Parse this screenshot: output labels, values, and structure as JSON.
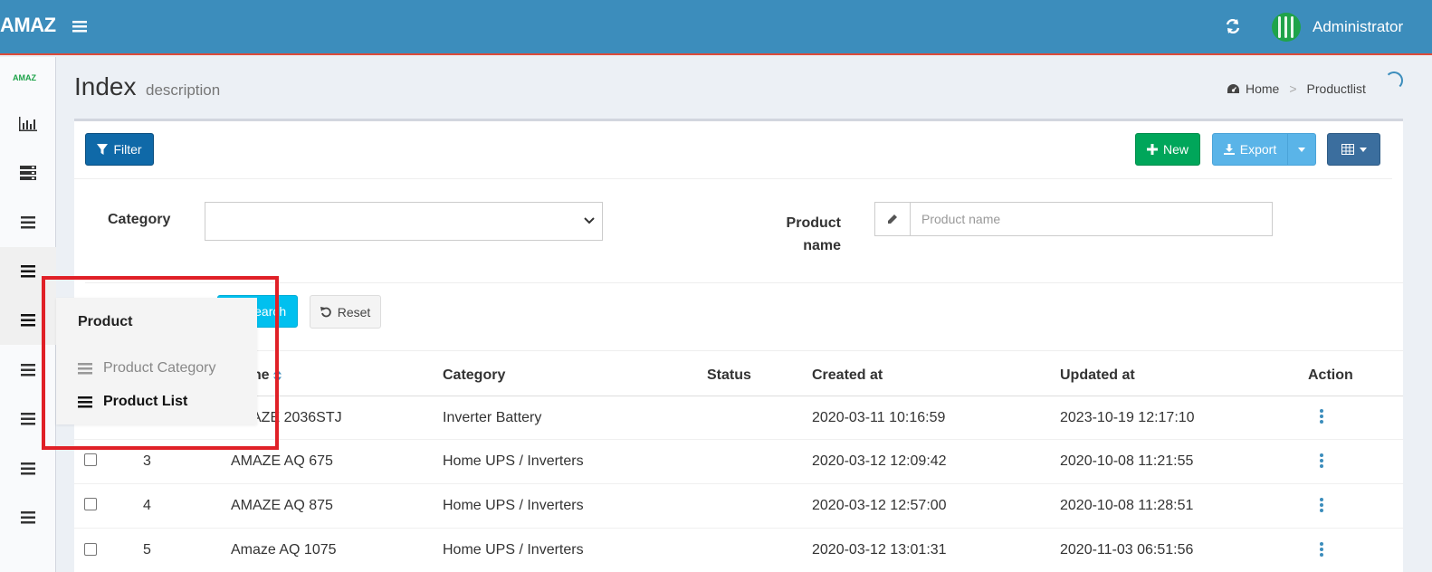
{
  "header": {
    "brand": "AMAZ",
    "user": "Administrator"
  },
  "sidebar": {
    "logo": "AMAZ"
  },
  "page": {
    "title": "Index",
    "description": "description",
    "breadcrumb": [
      {
        "label": "Home"
      },
      {
        "label": "Productlist"
      }
    ]
  },
  "toolbar": {
    "filter_label": "Filter",
    "new_label": "New",
    "export_label": "Export"
  },
  "filters": {
    "category_label": "Category",
    "category_value": "",
    "product_name_label_1": "Product",
    "product_name_label_2": "name",
    "product_name_placeholder": "Product name",
    "search_label": "Search",
    "reset_label": "Reset"
  },
  "table": {
    "headers": {
      "name": "Name",
      "category": "Category",
      "status": "Status",
      "created": "Created at",
      "updated": "Updated at",
      "action": "Action"
    },
    "rows": [
      {
        "id": "",
        "name": "AMAZE 2036STJ",
        "category": "Inverter Battery",
        "status": "",
        "created": "2020-03-11 10:16:59",
        "updated": "2023-10-19 12:17:10"
      },
      {
        "id": "3",
        "name": "AMAZE AQ 675",
        "category": "Home UPS / Inverters",
        "status": "",
        "created": "2020-03-12 12:09:42",
        "updated": "2020-10-08 11:21:55"
      },
      {
        "id": "4",
        "name": "AMAZE AQ 875",
        "category": "Home UPS / Inverters",
        "status": "",
        "created": "2020-03-12 12:57:00",
        "updated": "2020-10-08 11:28:51"
      },
      {
        "id": "5",
        "name": "Amaze AQ 1075",
        "category": "Home UPS / Inverters",
        "status": "",
        "created": "2020-03-12 13:01:31",
        "updated": "2020-11-03 06:51:56"
      }
    ]
  },
  "flyout": {
    "title": "Product",
    "items": [
      {
        "label": "Product Category"
      },
      {
        "label": "Product List"
      }
    ]
  },
  "colors": {
    "header": "#3c8dbc",
    "filter_button": "#0f69a8",
    "new_button": "#00a65a",
    "export_button": "#5ab4e8",
    "search_button": "#00c0ef",
    "highlight": "#e02027"
  }
}
